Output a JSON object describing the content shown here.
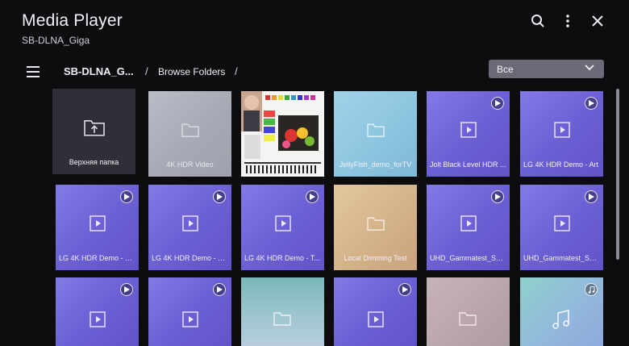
{
  "header": {
    "title": "Media Player",
    "subtitle": "SB-DLNA_Giga"
  },
  "icons": {
    "search": "search-icon",
    "more": "more-vertical-icon",
    "close": "close-icon",
    "menu": "hamburger-menu-icon"
  },
  "breadcrumb": {
    "root": "SB-DLNA_G...",
    "current": "Browse Folders",
    "sep": "/"
  },
  "filter": {
    "selected": "Все"
  },
  "tiles": [
    {
      "label": "Верхняя папка",
      "kind": "up-folder"
    },
    {
      "label": "4K HDR Video",
      "kind": "folder"
    },
    {
      "label": "",
      "kind": "image-thumb"
    },
    {
      "label": "JellyFish_demo_forTV",
      "kind": "folder"
    },
    {
      "label": "Jolt Black Level HDR ...",
      "kind": "video"
    },
    {
      "label": "LG 4K HDR Demo - Art",
      "kind": "video"
    },
    {
      "label": "LG 4K HDR Demo - N...",
      "kind": "video"
    },
    {
      "label": "LG 4K HDR Demo - R...",
      "kind": "video"
    },
    {
      "label": "LG 4K HDR Demo - T...",
      "kind": "video"
    },
    {
      "label": "Local Dimming Test",
      "kind": "folder"
    },
    {
      "label": "UHD_Gammatest_SD...",
      "kind": "video"
    },
    {
      "label": "UHD_Gammatest_SD...",
      "kind": "video"
    },
    {
      "label": "",
      "kind": "video"
    },
    {
      "label": "",
      "kind": "video"
    },
    {
      "label": "",
      "kind": "folder"
    },
    {
      "label": "",
      "kind": "video"
    },
    {
      "label": "",
      "kind": "folder"
    },
    {
      "label": "",
      "kind": "music"
    }
  ],
  "colors": {
    "background": "#0d0d10",
    "video_tile": "#7467dc",
    "filter_bg": "#6a6b76"
  }
}
